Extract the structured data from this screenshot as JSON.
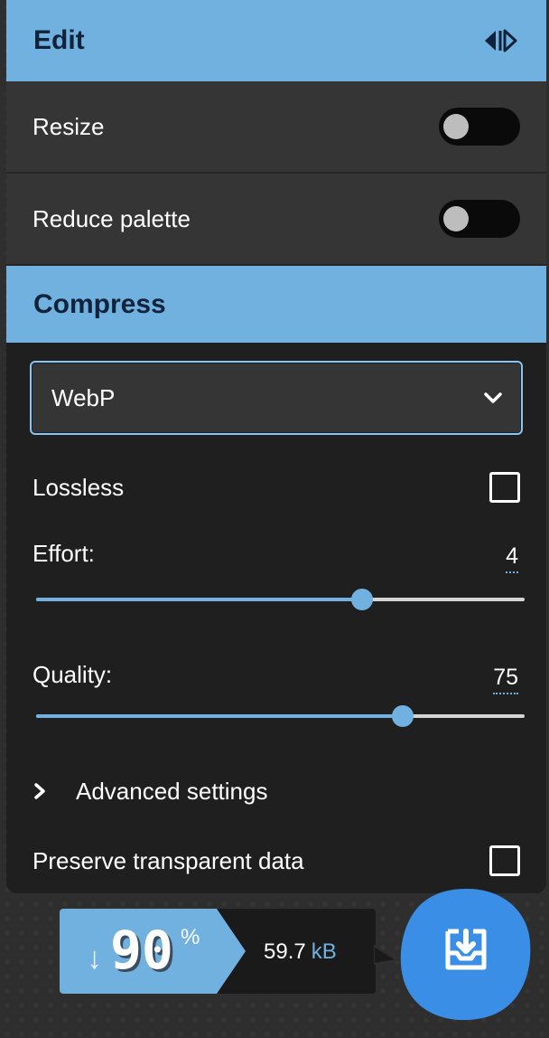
{
  "edit": {
    "title": "Edit",
    "collapse_icon": "panel-expand-collapse-icon",
    "options": [
      {
        "label": "Resize",
        "enabled": false
      },
      {
        "label": "Reduce palette",
        "enabled": false
      }
    ]
  },
  "compress": {
    "title": "Compress",
    "format": {
      "selected": "WebP",
      "icon": "chevron-down-icon"
    },
    "lossless": {
      "label": "Lossless",
      "checked": false
    },
    "effort": {
      "label": "Effort:",
      "value": "4",
      "fraction": 0.667
    },
    "quality": {
      "label": "Quality:",
      "value": "75",
      "fraction": 0.75
    },
    "advanced": {
      "label": "Advanced settings",
      "icon": "chevron-right-icon"
    },
    "preserve": {
      "label": "Preserve transparent data",
      "checked": false
    }
  },
  "results": {
    "arrow": "↓",
    "percent": "90",
    "percent_sign": "%",
    "size": "59.7",
    "unit": "kB",
    "download_icon": "download-icon"
  },
  "colors": {
    "accent": "#71b1e0",
    "header_text": "#11233a",
    "download_button": "#3b8ee6"
  }
}
